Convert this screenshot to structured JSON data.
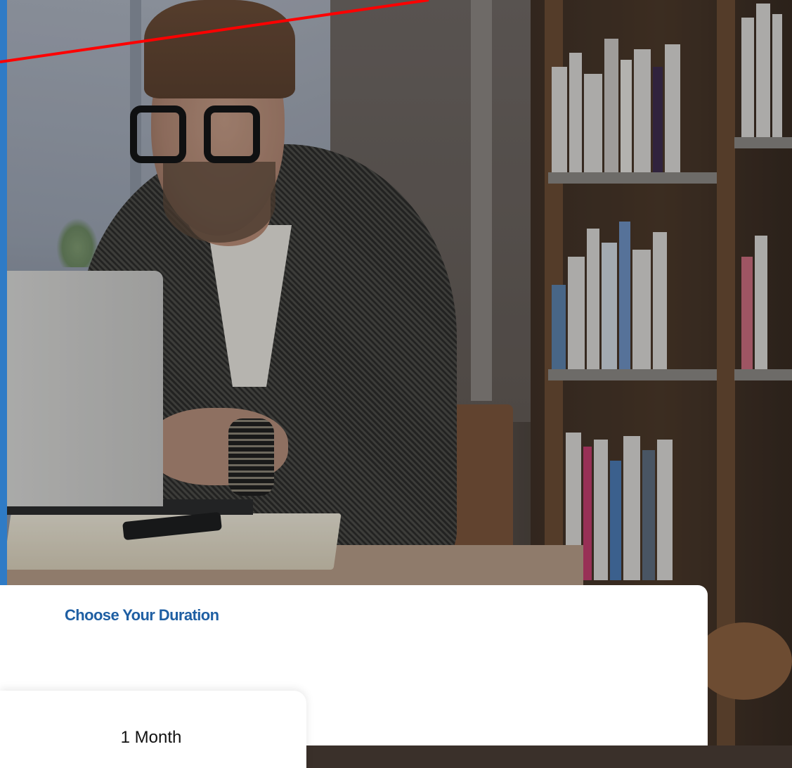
{
  "hero": {
    "image_alt": "Man with glasses typing on a laptop in a library",
    "accent_color": "#2f7bc6",
    "annotation_color": "#ff0000"
  },
  "duration_card": {
    "title": "Choose Your Duration",
    "title_color": "#1f5fa3",
    "options": [
      {
        "label": "1 Month"
      }
    ]
  }
}
